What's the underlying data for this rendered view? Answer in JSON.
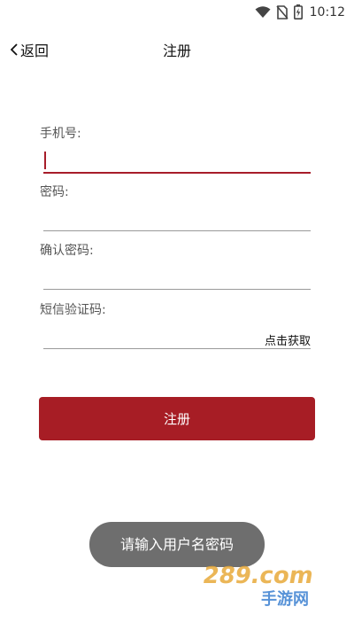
{
  "status_bar": {
    "time": "10:12"
  },
  "header": {
    "back_label": "返回",
    "title": "注册"
  },
  "form": {
    "phone": {
      "label": "手机号:",
      "value": ""
    },
    "password": {
      "label": "密码:",
      "value": ""
    },
    "confirm_password": {
      "label": "确认密码:",
      "value": ""
    },
    "sms_code": {
      "label": "短信验证码:",
      "value": "",
      "get_code_label": "点击获取"
    },
    "submit_label": "注册"
  },
  "toast": {
    "message": "请输入用户名密码"
  },
  "watermark": {
    "text": "289.com",
    "subtext": "手游网"
  },
  "colors": {
    "accent": "#a71d25",
    "toast_bg": "#6e6e6e"
  }
}
